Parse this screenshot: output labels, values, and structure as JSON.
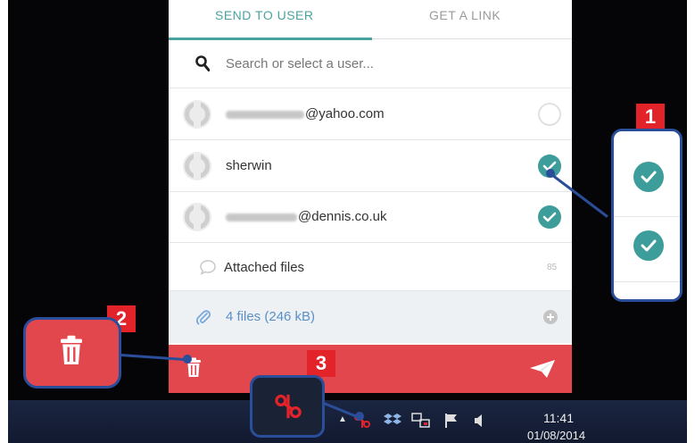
{
  "tabs": {
    "send_to_user": "SEND TO USER",
    "get_a_link": "GET A LINK"
  },
  "search": {
    "placeholder": "Search or select a user..."
  },
  "users": [
    {
      "visible_name": "@yahoo.com",
      "selected": false
    },
    {
      "visible_name": "sherwin",
      "selected": true
    },
    {
      "visible_name": "@dennis.co.uk",
      "selected": true
    }
  ],
  "attachments": {
    "label": "Attached files",
    "count": "85",
    "files_summary": "4 files (246 kB)"
  },
  "taskbar": {
    "time": "11:41",
    "date": "01/08/2014"
  },
  "callouts": {
    "one": "1",
    "two": "2",
    "three": "3"
  },
  "colors": {
    "accent_teal": "#3d9d9a",
    "bar_red": "#e2474e",
    "callout_red": "#e2232a",
    "callout_blue": "#2a4e9a"
  },
  "icons": [
    "search-icon",
    "avatar-icon",
    "check-icon",
    "chat-bubble-icon",
    "paperclip-icon",
    "add-icon",
    "trash-icon",
    "send-icon",
    "app-tray-icon",
    "dropbox-icon",
    "network-icon",
    "flag-icon",
    "volume-icon"
  ]
}
